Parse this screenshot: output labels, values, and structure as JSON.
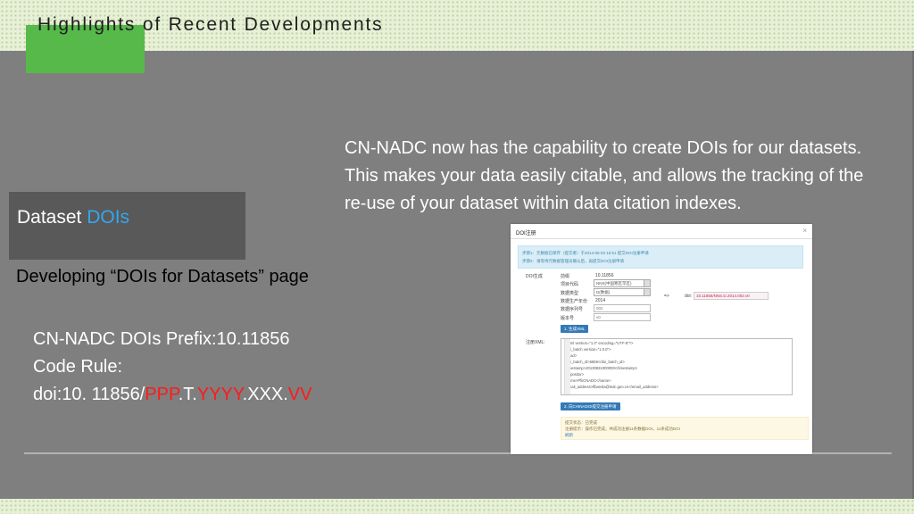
{
  "slide": {
    "title": "Highlights of Recent Developments",
    "dataset_label_prefix": "Dataset",
    "dataset_label_accent": "DOIs",
    "developing_text": "Developing “DOIs for Datasets” page",
    "prefix_line": "CN-NADC DOIs Prefix:10.11856",
    "code_rule_line": "Code Rule:",
    "rule": {
      "a": "doi:10. 11856/",
      "b": "PPP",
      "c": ".T.",
      "d": "YYYY",
      "e": ".XXX.",
      "f": "VV"
    },
    "paragraph": "CN-NADC now has the capability to create DOIs for our datasets. This makes your data easily citable, and allows the tracking of the re-use of your dataset within data citation indexes.",
    "colors": {
      "accent_blue": "#34a6ee",
      "rule_red": "#ff1a1a",
      "green_block": "#56b94a",
      "gray_bg": "#7f7f7f"
    }
  },
  "dialog": {
    "title": "DOI注册",
    "close": "×",
    "info_line1": "步骤1：元数据已保存（提交者）于2014-06-03 16:51 提交DOI注册申请",
    "info_line2": "步骤2：请等待元数据管理员确认后，再提交DOI注册申请",
    "doi_gen_label": "DOI生成",
    "fields": [
      {
        "key": "前缀",
        "value": "10.11856"
      },
      {
        "key": "项目代码",
        "value": "NNS(中国寒区旱区)"
      },
      {
        "key": "数据类型",
        "value": "D(数据)"
      },
      {
        "key": "数据生产年份",
        "value": "2014"
      },
      {
        "key": "数据序列号",
        "value": "002"
      },
      {
        "key": "版本号",
        "value": "v0"
      }
    ],
    "arrow": "=>",
    "doi_label": "doi:",
    "doi_value": "10.11856/NNS.D.2014.002.v0",
    "gen_xml_button": "1. 生成XML",
    "xml_label": "注册XML:",
    "xml_lines": [
      "<?xml version=\"1.0\" encoding=\"UTF-8\"?>",
      "<doi_batch version=\"1.0.0\">",
      "  <head>",
      "    <doi_batch_id>5859</doi_batch_id>",
      "    <timestamp>20130831000000</timestamp>",
      "  <depositor>",
      "    <name>PfiiCNADC</name>",
      "    <email_address>lfbansla@ledc.geo.cn</email_address>"
    ],
    "submit_button": "2. 向CHINADOI提交注册申请",
    "status_line1": "提交状态：已完成",
    "status_line2": "注册提示：操作已完成，共成功注册11条数据DOI，11条成功DOI",
    "status_line3": "刷新"
  }
}
